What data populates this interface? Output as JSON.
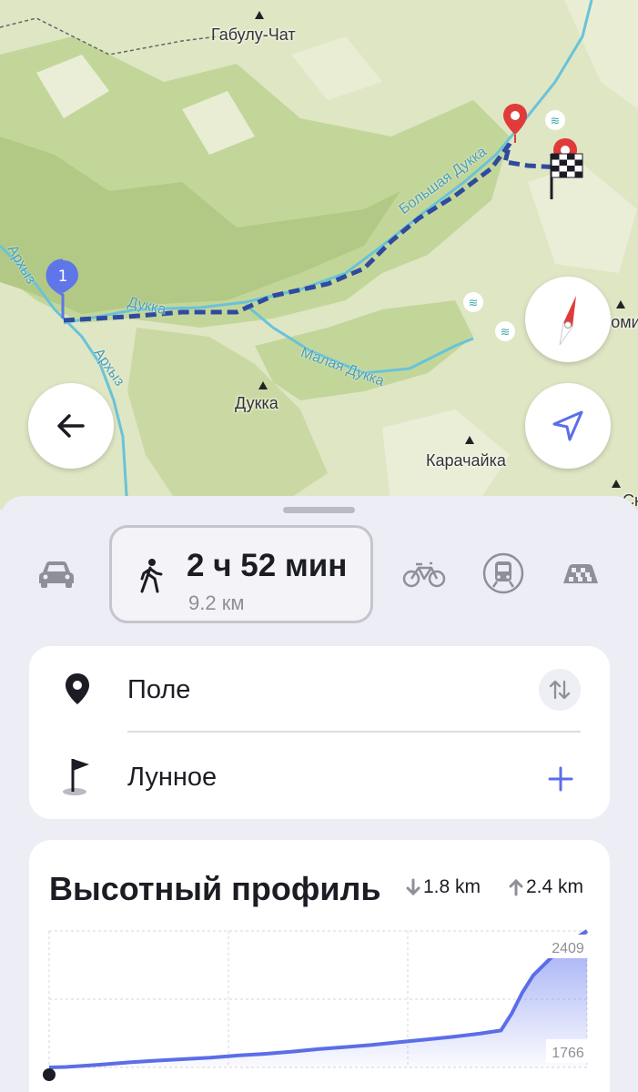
{
  "map": {
    "place_labels": [
      "Габулу-Чат",
      "Дукка",
      "Карачайка",
      "Роми",
      "Ск"
    ],
    "river_labels": [
      "Дукка",
      "Большая Дукка",
      "Малая Дукка",
      "Архыз",
      "Архыз"
    ],
    "waypoint_number": "1",
    "back_icon": "arrow-left-icon",
    "compass_icon": "compass-icon",
    "locate_icon": "navigation-arrow-icon",
    "finish_icon": "checkered-flag-icon",
    "colors": {
      "route": "#2f4a9e",
      "marker_blue": "#5e76e8",
      "marker_red": "#e03b3b",
      "river": "#69c3d8"
    }
  },
  "modes": {
    "items": [
      "car",
      "walk",
      "bicycle",
      "transit",
      "taxi"
    ],
    "selected": "walk",
    "duration": "2 ч 52 мин",
    "distance": "9.2 км"
  },
  "route": {
    "from": "Поле",
    "to": "Лунное",
    "from_icon": "location-pin-icon",
    "to_icon": "flag-icon",
    "swap_icon": "swap-vertical-icon",
    "add_icon": "plus-icon"
  },
  "elevation": {
    "title": "Высотный профиль",
    "descent": "1.8 km",
    "ascent": "2.4 km",
    "max_label": "2409",
    "min_label": "1766",
    "accent": "#5b6ee8"
  },
  "chart_data": {
    "type": "area",
    "title": "Высотный профиль",
    "xlabel": "",
    "ylabel": "",
    "x": [
      0,
      0.03,
      0.06,
      0.1,
      0.15,
      0.2,
      0.25,
      0.3,
      0.35,
      0.4,
      0.45,
      0.5,
      0.55,
      0.6,
      0.65,
      0.7,
      0.75,
      0.8,
      0.84,
      0.86,
      0.88,
      0.9,
      0.93,
      0.96,
      1.0
    ],
    "series": [
      {
        "values": [
          1766,
          1768,
          1773,
          1780,
          1790,
          1798,
          1805,
          1812,
          1822,
          1830,
          1840,
          1852,
          1862,
          1872,
          1885,
          1897,
          1910,
          1925,
          1940,
          2020,
          2120,
          2200,
          2275,
          2345,
          2409
        ]
      }
    ],
    "ylim": [
      1766,
      2409
    ],
    "grid": true
  }
}
